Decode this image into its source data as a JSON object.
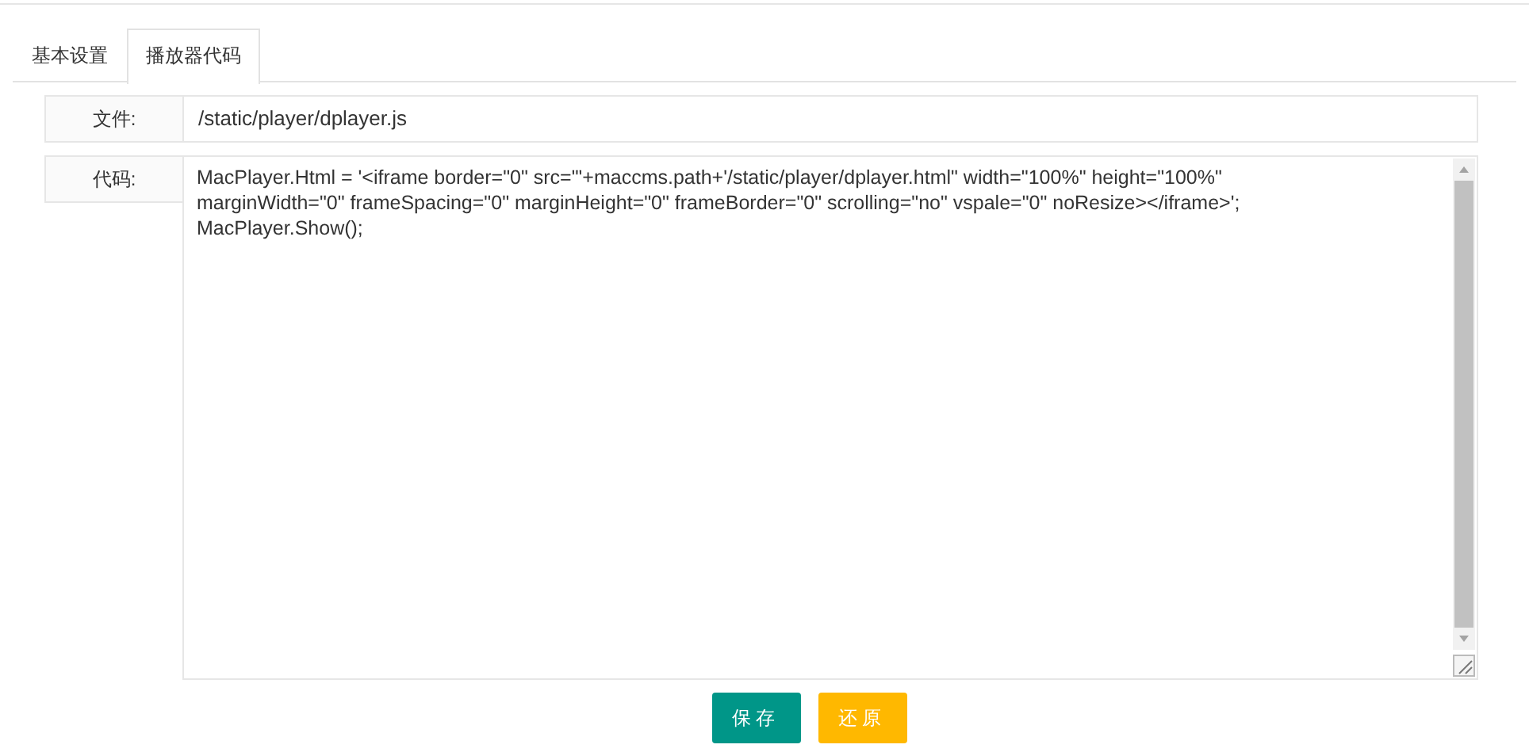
{
  "tabs": [
    {
      "label": "基本设置",
      "selected": false
    },
    {
      "label": "播放器代码",
      "selected": true
    }
  ],
  "file": {
    "label": "文件:",
    "value": "/static/player/dplayer.js"
  },
  "code": {
    "label": "代码:",
    "value": "MacPlayer.Html = '<iframe border=\"0\" src=\"'+maccms.path+'/static/player/dplayer.html\" width=\"100%\" height=\"100%\" marginWidth=\"0\" frameSpacing=\"0\" marginHeight=\"0\" frameBorder=\"0\" scrolling=\"no\" vspale=\"0\" noResize></iframe>';\nMacPlayer.Show();"
  },
  "buttons": [
    {
      "label": "保存",
      "kind": "primary"
    },
    {
      "label": "还原",
      "kind": "warning"
    }
  ]
}
